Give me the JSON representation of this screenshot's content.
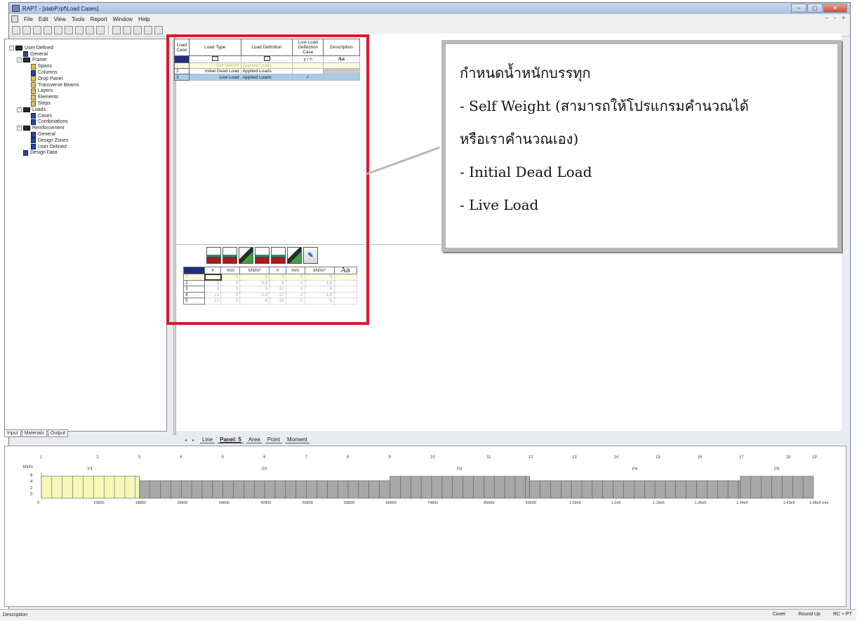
{
  "window": {
    "title": "RAPT - [slabP.rpf\\Load Cases]",
    "controls": [
      "–",
      "▢",
      "✕"
    ],
    "mdi_controls": "– ▫ ×"
  },
  "menu": [
    "File",
    "Edit",
    "View",
    "Tools",
    "Report",
    "Window",
    "Help"
  ],
  "tree": [
    {
      "label": "User Defined",
      "level": 0,
      "type": "folder"
    },
    {
      "label": "General",
      "level": 1,
      "type": "page"
    },
    {
      "label": "Frame",
      "level": 1,
      "type": "folder"
    },
    {
      "label": "Spans",
      "level": 2,
      "type": "pagey"
    },
    {
      "label": "Columns",
      "level": 2,
      "type": "page"
    },
    {
      "label": "Drop Panel",
      "level": 2,
      "type": "pagey"
    },
    {
      "label": "Transverse Beams",
      "level": 2,
      "type": "pagey"
    },
    {
      "label": "Layers",
      "level": 2,
      "type": "pagey"
    },
    {
      "label": "Elements",
      "level": 2,
      "type": "pagey"
    },
    {
      "label": "Steps",
      "level": 2,
      "type": "pagey"
    },
    {
      "label": "Loads",
      "level": 1,
      "type": "folder"
    },
    {
      "label": "Cases",
      "level": 2,
      "type": "page"
    },
    {
      "label": "Combinations",
      "level": 2,
      "type": "page"
    },
    {
      "label": "Reinforcement",
      "level": 1,
      "type": "folder"
    },
    {
      "label": "General",
      "level": 2,
      "type": "page"
    },
    {
      "label": "Design Zones",
      "level": 2,
      "type": "page"
    },
    {
      "label": "User Defined",
      "level": 2,
      "type": "page"
    },
    {
      "label": "Design Data",
      "level": 1,
      "type": "page"
    }
  ],
  "left_tabs": [
    "Input",
    "Materials",
    "Output"
  ],
  "load_cases": {
    "headers": [
      "Load Case",
      "Load Type",
      "Load Definition",
      "Live Load Deflection Case",
      "Description"
    ],
    "unit_row": {
      "deflection": "y / n",
      "description": "Aa"
    },
    "rows": [
      {
        "no": "1",
        "type": "Self Weight",
        "definition": "Applied Loads",
        "deflection": ""
      },
      {
        "no": "2",
        "type": "Initial Dead Load",
        "definition": "Applied Loads",
        "deflection": ""
      },
      {
        "no": "3",
        "type": "Live Load",
        "definition": "Applied Loads",
        "deflection": "✓"
      }
    ]
  },
  "panel_loads": {
    "units": [
      "#",
      "mm",
      "kN/m²",
      "#",
      "mm",
      "kN/m²",
      "Aa"
    ],
    "rows": [
      [
        "1",
        "",
        "0",
        "6",
        "3",
        "0",
        "6",
        ""
      ],
      [
        "2",
        "3",
        "0",
        "4.8",
        "9",
        "0",
        "4.8",
        ""
      ],
      [
        "3",
        "9",
        "0",
        "6",
        "12",
        "0",
        "6",
        ""
      ],
      [
        "4",
        "12",
        "0",
        "4.8",
        "17",
        "0",
        "4.8",
        ""
      ],
      [
        "5",
        "17",
        "0",
        "6",
        "19",
        "0",
        "6",
        ""
      ]
    ]
  },
  "callout": [
    "กำหนดน้ำหนักบรรทุก",
    "- Self Weight (สามารถให้โปรแกรมคำนวณได้",
    "หรือเราคำนวณเอง)",
    "- Initial Dead Load",
    "- Live Load"
  ],
  "bottom_tabs": [
    "Line",
    "Panel: 5",
    "Area",
    "Point",
    "Moment"
  ],
  "diagram": {
    "unit_label": "kN/m",
    "y_ticks": [
      "6",
      "4",
      "2",
      "0"
    ],
    "support_numbers": [
      "1",
      "2",
      "3",
      "4",
      "5",
      "6",
      "7",
      "8",
      "9",
      "10",
      "11",
      "12",
      "13",
      "14",
      "15",
      "16",
      "17",
      "18",
      "19"
    ],
    "panel_labels": [
      "P1",
      "P2",
      "P3",
      "P4",
      "P5"
    ],
    "x_labels": [
      "0",
      "10800",
      "18800",
      "26800",
      "34800",
      "42800",
      "50800",
      "58800",
      "66800",
      "74800",
      "85600",
      "93600",
      "1.02e5",
      "1.1e5",
      "1.18e5",
      "1.26e5",
      "1.34e5",
      "1.43e5",
      "1.48e5 mm"
    ],
    "panels": [
      {
        "from": 0,
        "to": 18800,
        "value": 6,
        "color": "#f6f8b8"
      },
      {
        "from": 18800,
        "to": 66800,
        "value": 4.8,
        "color": "#a8a8a8"
      },
      {
        "from": 66800,
        "to": 93600,
        "value": 6,
        "color": "#a8a8a8"
      },
      {
        "from": 93600,
        "to": 134000,
        "value": 4.8,
        "color": "#a8a8a8"
      },
      {
        "from": 134000,
        "to": 148000,
        "value": 6,
        "color": "#a8a8a8"
      }
    ]
  },
  "status": {
    "left": "Description",
    "cover": "Cover",
    "round": "Round Up",
    "mode": "RC + PT"
  }
}
